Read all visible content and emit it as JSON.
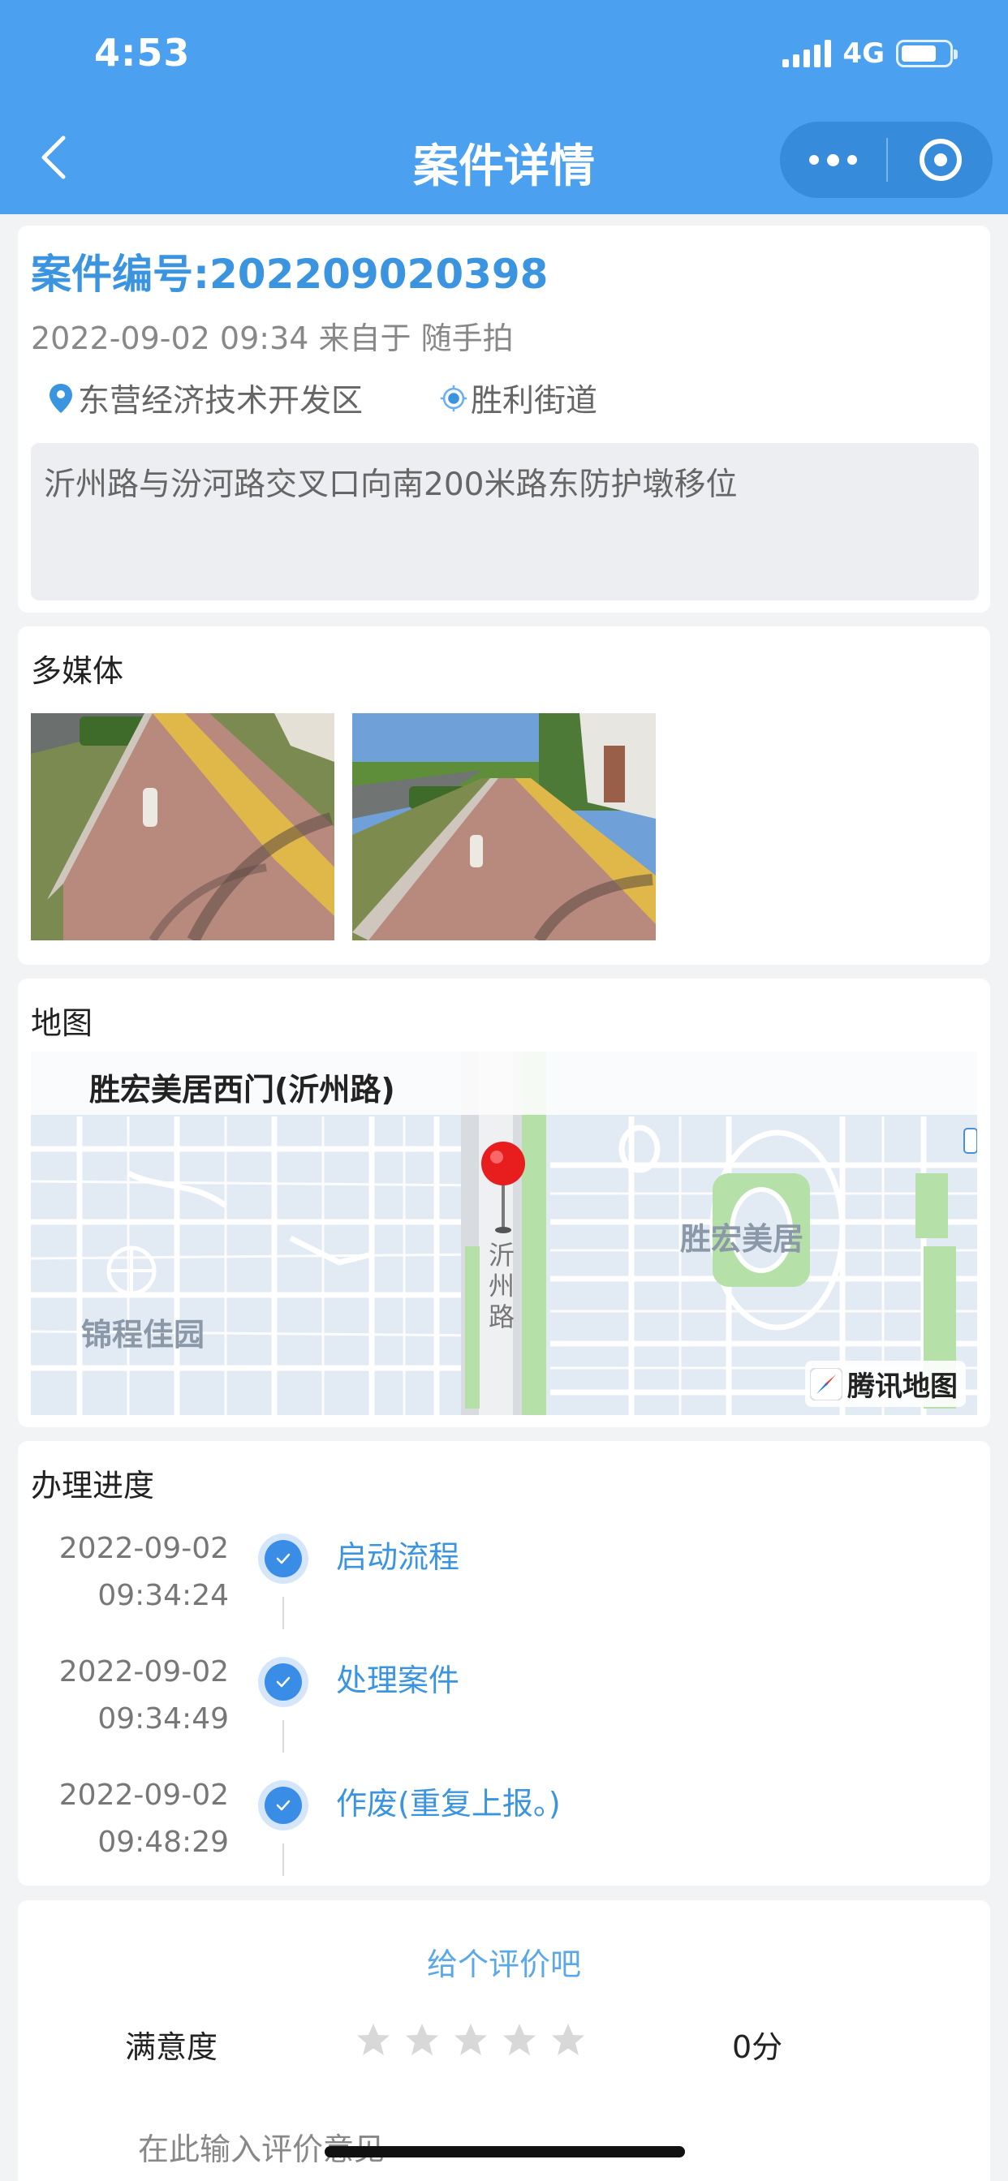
{
  "status": {
    "time": "4:53",
    "network": "4G",
    "battery_level": 0.75
  },
  "nav": {
    "title": "案件详情"
  },
  "case": {
    "number": "案件编号:202209020398",
    "meta": "2022-09-02 09:34 来自于 随手拍",
    "district": "东营经济技术开发区",
    "street": "胜利街道",
    "description": "沂州路与汾河路交叉口向南200米路东防护墩移位"
  },
  "media": {
    "title": "多媒体"
  },
  "map": {
    "title": "地图",
    "place": "胜宏美居西门(沂州路)",
    "labels": {
      "community_a": "胜宏美居",
      "community_b": "锦程佳园",
      "road": "沂州路"
    },
    "logo": "腾讯地图"
  },
  "progress": {
    "title": "办理进度",
    "steps": [
      {
        "date": "2022-09-02",
        "time": "09:34:24",
        "label": "启动流程"
      },
      {
        "date": "2022-09-02",
        "time": "09:34:49",
        "label": "处理案件"
      },
      {
        "date": "2022-09-02",
        "time": "09:48:29",
        "label": "作废(重复上报。)"
      }
    ]
  },
  "rating": {
    "title": "给个评价吧",
    "label": "满意度",
    "stars_total": 5,
    "stars_filled": 0,
    "score": "0分",
    "comment_placeholder": "在此输入评价意见"
  },
  "colors": {
    "accent": "#4ba0f0",
    "link": "#3a94e0",
    "check": "#3a8de6"
  }
}
